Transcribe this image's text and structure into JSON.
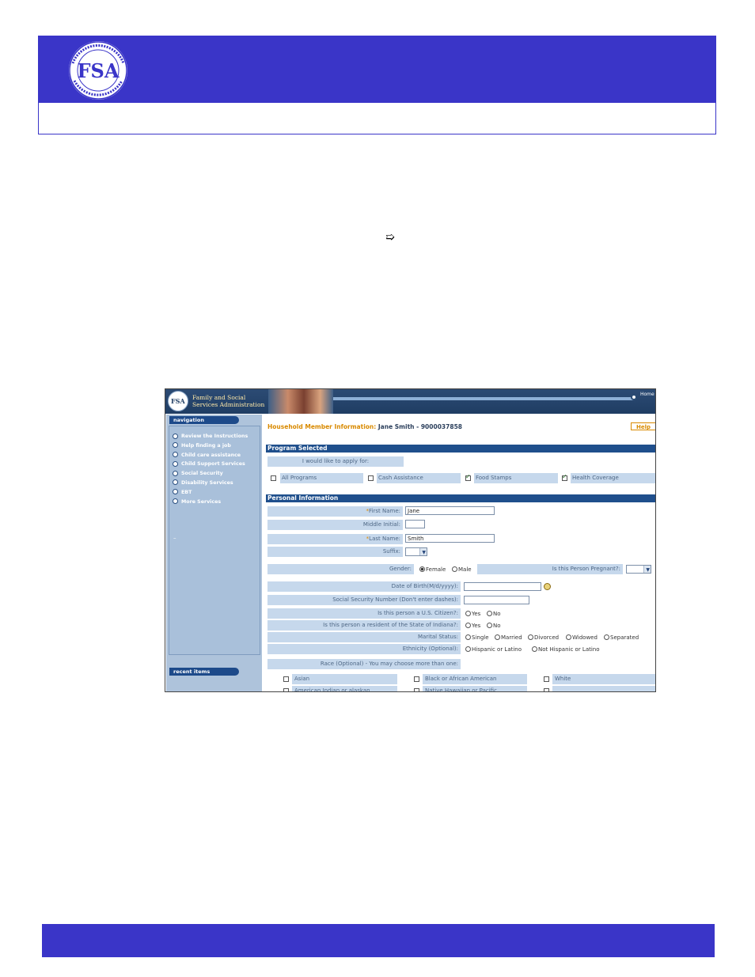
{
  "document": {
    "arrow": "➯"
  },
  "app": {
    "org_name_line1": "Family and Social",
    "org_name_line2": "Services Administration",
    "logo_text": "FSA",
    "home_label": "Home"
  },
  "nav": {
    "header": "navigation",
    "items": [
      "Review the Instructions",
      "Help finding a job",
      "Child care assistance",
      "Child Support Services",
      "Social Security",
      "Disability Services",
      "EBT",
      "More Services"
    ],
    "dash": "–",
    "recent_header": "recent items"
  },
  "page": {
    "title_label": "Household Member Information:",
    "title_value": "Jane Smith - 9000037858",
    "help_label": "Help"
  },
  "program": {
    "section_title": "Program Selected",
    "prompt": "I would like to apply for:",
    "options": [
      {
        "label": "All Programs",
        "checked": false
      },
      {
        "label": "Cash Assistance",
        "checked": false
      },
      {
        "label": "Food Stamps",
        "checked": true
      },
      {
        "label": "Health Coverage",
        "checked": true
      }
    ]
  },
  "personal": {
    "section_title": "Personal Information",
    "first_name_label": "First Name:",
    "first_name_value": "Jane",
    "middle_initial_label": "Middle Initial:",
    "middle_initial_value": "",
    "last_name_label": "Last Name:",
    "last_name_value": "Smith",
    "suffix_label": "Suffix:",
    "gender_label": "Gender:",
    "gender_options": [
      "Female",
      "Male"
    ],
    "gender_selected": "Female",
    "pregnant_label": "Is this Person Pregnant?:",
    "dob_label": "Date of Birth(M/d/yyyy):",
    "ssn_label": "Social Security Number (Don't enter dashes):",
    "citizen_label": "Is this person a U.S. Citizen?:",
    "resident_label": "Is this person a resident of the State of Indiana?:",
    "yes_label": "Yes",
    "no_label": "No",
    "marital_label": "Marital Status:",
    "marital_options": [
      "Single",
      "Married",
      "Divorced",
      "Widowed",
      "Separated"
    ],
    "ethnicity_label": "Ethnicity (Optional):",
    "ethnicity_options": [
      "Hispanic or Latino",
      "Not Hispanic or Latino"
    ],
    "race_label": "Race (Optional) - You may choose more than one:",
    "race_options": [
      "Asian",
      "Black or African American",
      "White",
      "American Indian or alaskan",
      "Native Hawaiian or Pacific"
    ]
  },
  "colors": {
    "brand_blue": "#3a35c8",
    "app_navy": "#1f4f8c",
    "accent_orange": "#d98a00",
    "field_bg": "#c6d8ec",
    "sidebar_bg": "#aec3db"
  }
}
